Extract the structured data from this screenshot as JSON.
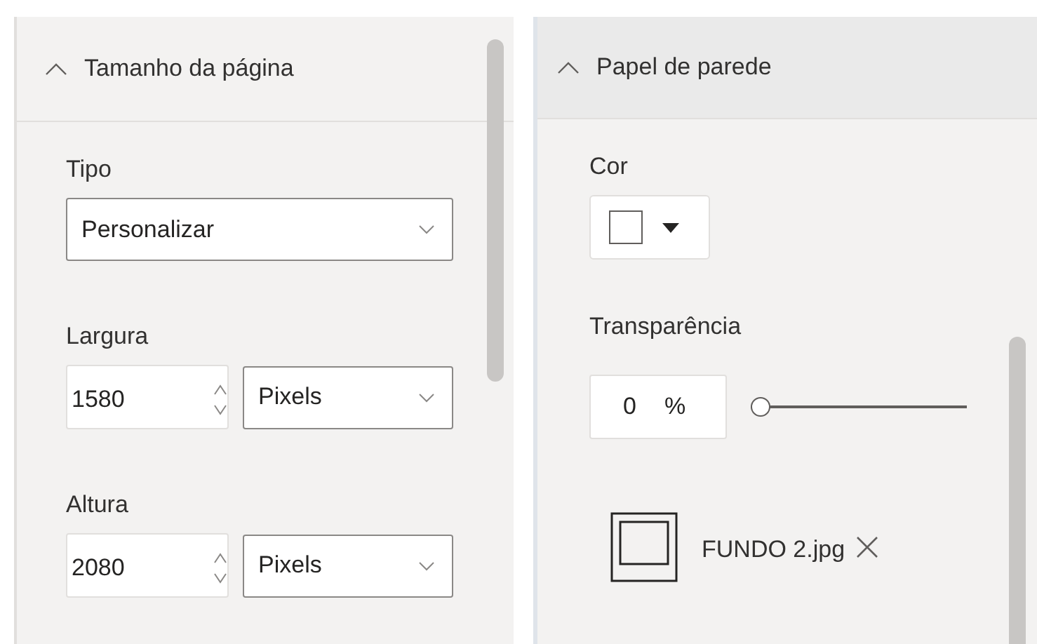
{
  "left_section": {
    "title": "Tamanho da página",
    "expanded": true,
    "fields": [
      {
        "kind": "dropdown",
        "label": "Tipo",
        "value": "Personalizar"
      },
      {
        "kind": "spin_unit",
        "label": "Largura",
        "value": "1580",
        "unit": "Pixels"
      },
      {
        "kind": "spin_unit",
        "label": "Altura",
        "value": "2080",
        "unit": "Pixels"
      }
    ]
  },
  "right_section": {
    "title": "Papel de parede",
    "expanded": true,
    "color_label": "Cor",
    "transparency_label": "Transparência",
    "transparency_value": "0",
    "transparency_unit": "%",
    "level": 0,
    "image_file": "FUNDO 2.jpg"
  }
}
